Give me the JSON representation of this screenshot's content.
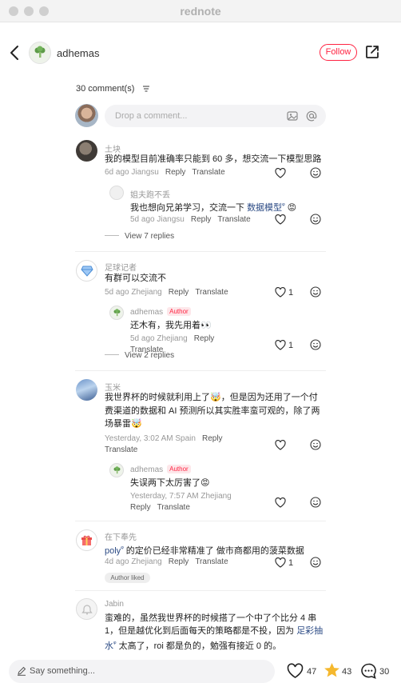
{
  "window": {
    "title": "rednote"
  },
  "header": {
    "author": "adhemas",
    "follow_label": "Follow"
  },
  "comments_section": {
    "count_label": "30 comment(s)",
    "input_placeholder": "Drop a comment..."
  },
  "comments": [
    {
      "name": "土块",
      "text": "我的模型目前准确率只能到 60 多，想交流一下模型思路",
      "meta": "6d ago Jiangsu",
      "reply": "Reply",
      "translate": "Translate",
      "replies": [
        {
          "name": "姐夫跑不丢",
          "text": "我也想向兄弟学习，交流一下",
          "link": "数据模型",
          "emoji": "😡",
          "meta": "5d ago Jiangsu",
          "reply": "Reply",
          "translate": "Translate"
        }
      ],
      "view_replies": "View 7 replies"
    },
    {
      "name": "足球记者",
      "text": "有群可以交流不",
      "meta": "5d ago Zhejiang",
      "reply": "Reply",
      "translate": "Translate",
      "likes": "1",
      "replies": [
        {
          "name": "adhemas",
          "author_tag": "Author",
          "text": "还木有，我先用着👀",
          "meta": "5d ago Zhejiang",
          "reply": "Reply",
          "translate": "Translate",
          "likes": "1"
        }
      ],
      "view_replies": "View 2 replies"
    },
    {
      "name": "玉米",
      "line1": "我世界杯的时候就利用上了🤯，但是因为还用了一个付",
      "line2": "费渠道的数据和 AI 预测所以其实胜率蛮可观的，除了两",
      "line3": "场暴雷🤯",
      "meta": "Yesterday, 3:02 AM Spain",
      "reply": "Reply",
      "translate": "Translate",
      "replies": [
        {
          "name": "adhemas",
          "author_tag": "Author",
          "text": "失误两下太厉害了😡",
          "meta": "Yesterday, 7:57 AM Zhejiang",
          "reply": "Reply",
          "translate": "Translate"
        }
      ]
    },
    {
      "name": "在下奉先",
      "link": "poly",
      "text": " 的定价已经非常精准了 做市商都用的菠菜数据",
      "meta": "4d ago Zhejiang",
      "reply": "Reply",
      "translate": "Translate",
      "likes": "1",
      "badge": "Author liked"
    },
    {
      "name": "Jabin",
      "line1": "蛮难的，虽然我世界杯的时候搭了一个中了个比分 4 串",
      "line2a": "1，但是越优化到后面每天的策略都是不投，因为 ",
      "link": "足彩抽",
      "link2": "水",
      "line3": " 太高了，roi 都是负的，勉强有接近 0 的。"
    }
  ],
  "bottom_bar": {
    "placeholder": "Say something...",
    "likes": "47",
    "stars": "43",
    "comments": "30"
  },
  "colors": {
    "accent": "#ff2442",
    "star": "#f5b82e",
    "link": "#2c4b85"
  }
}
